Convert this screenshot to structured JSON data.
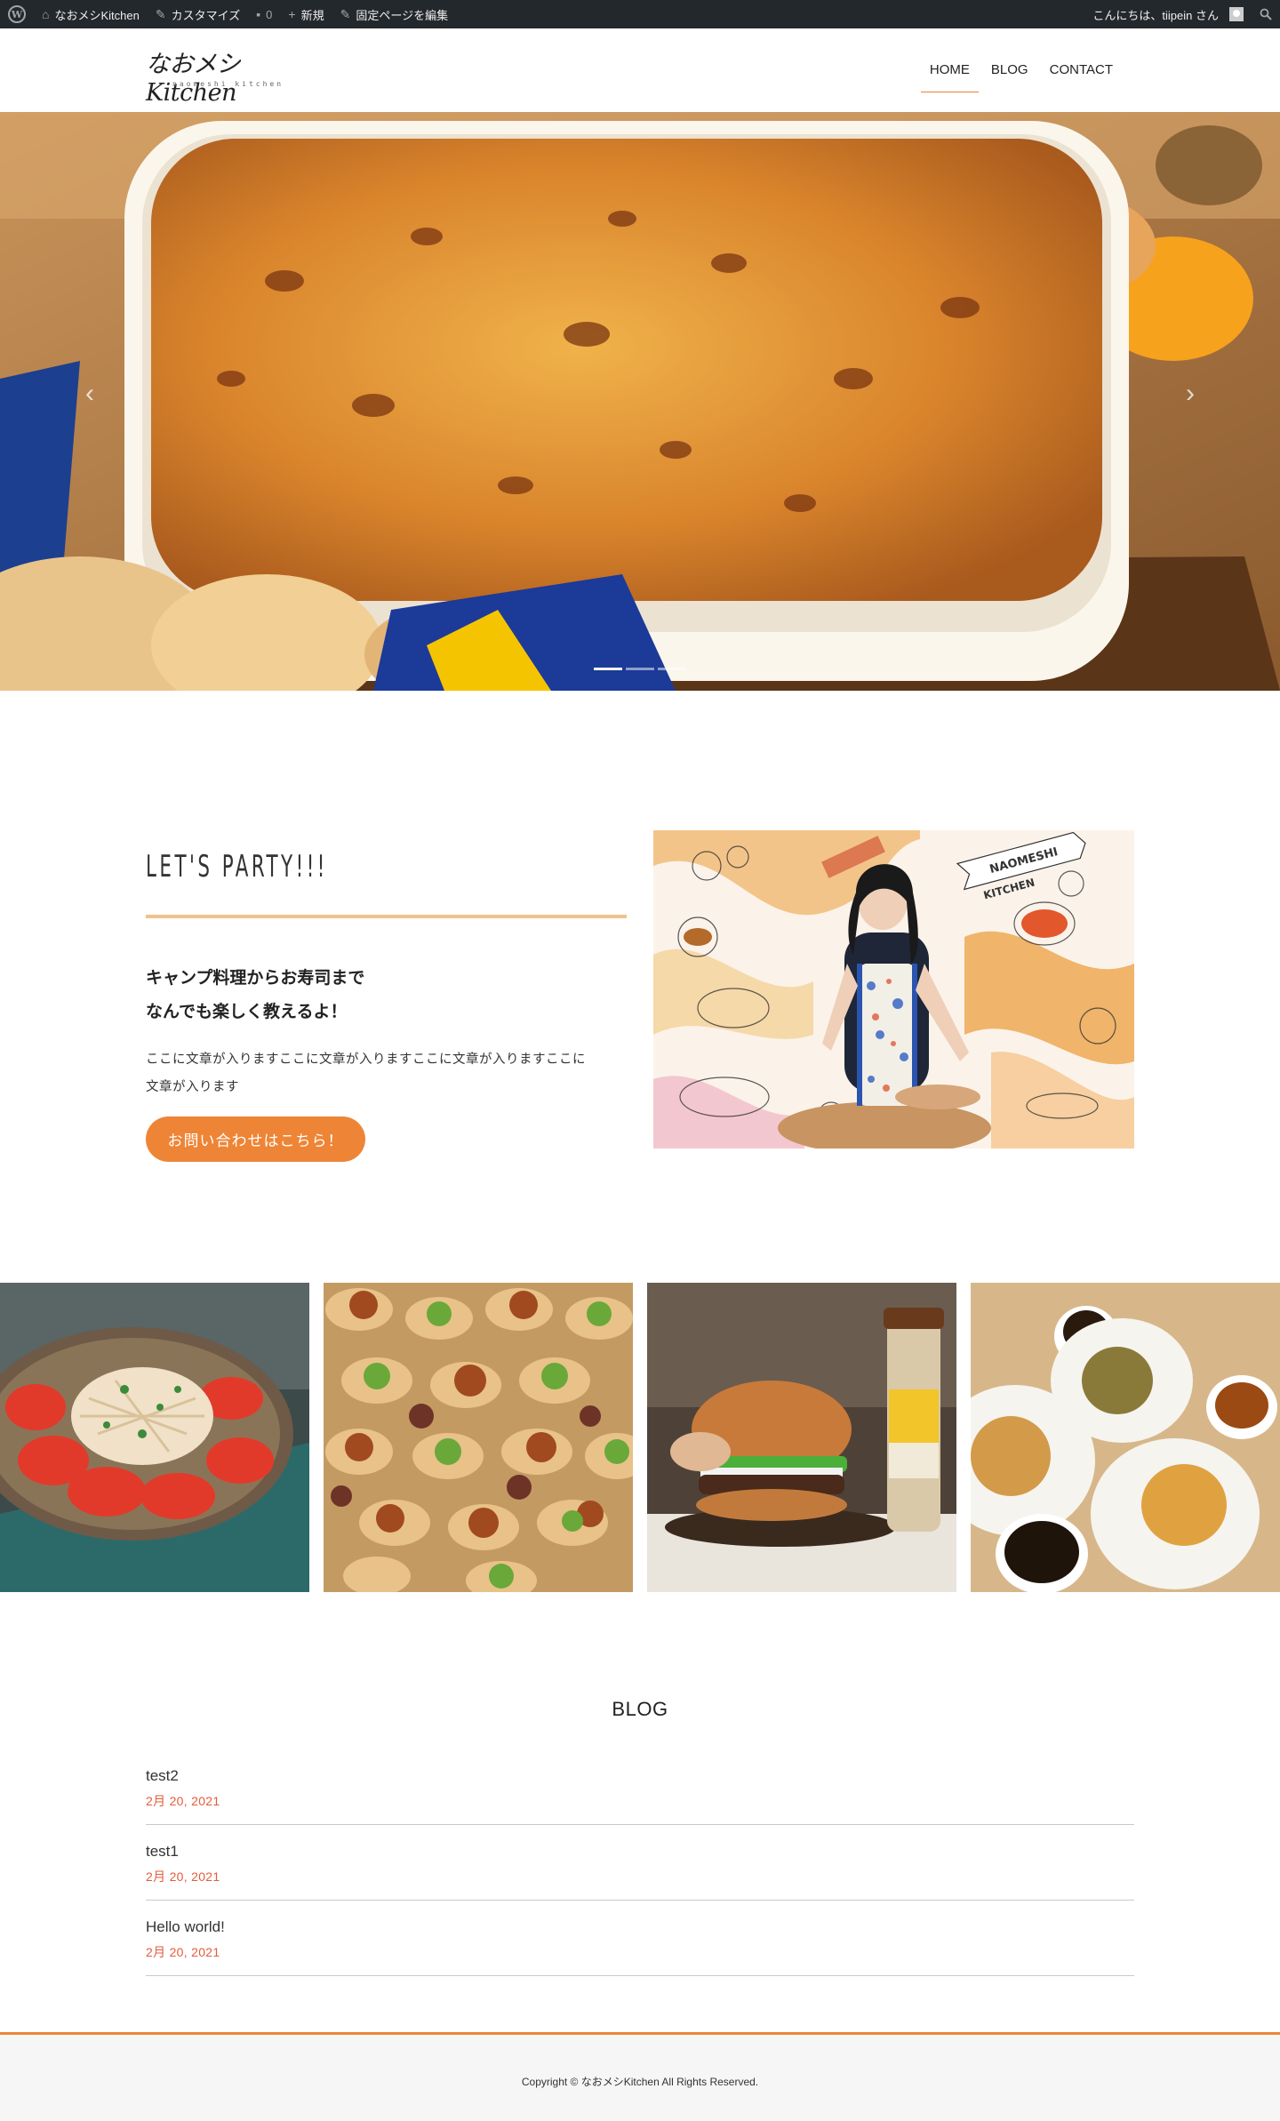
{
  "admin_bar": {
    "site_name": "なおメシKitchen",
    "customize": "カスタマイズ",
    "comments_count": "0",
    "new": "新規",
    "edit_page": "固定ページを編集",
    "greeting": "こんにちは、tiipein さん"
  },
  "header": {
    "logo_text": "なおメシKitchen",
    "logo_sub": "naomeshi kitchen",
    "nav": [
      {
        "label": "HOME",
        "active": true
      },
      {
        "label": "BLOG",
        "active": false
      },
      {
        "label": "CONTACT",
        "active": false
      }
    ]
  },
  "hero": {
    "prev_icon": "chevron-left-icon",
    "next_icon": "chevron-right-icon",
    "prev_glyph": "‹",
    "next_glyph": "›",
    "slides": 3,
    "active_slide": 1
  },
  "party": {
    "title": "LET'S PARTY!!!",
    "lead_line1": "キャンプ料理からお寿司まで",
    "lead_line2": "なんでも楽しく教えるよ！",
    "body_line1": "ここに文章が入りますここに文章が入りますここに文章が入りますここに",
    "body_line2": "文章が入ります",
    "button": "お問い合わせはこちら！",
    "badge_line1": "NAOMESHI",
    "badge_line2": "KITCHEN"
  },
  "blog": {
    "heading": "BLOG",
    "posts": [
      {
        "title": "test2",
        "date": "2月 20, 2021"
      },
      {
        "title": "test1",
        "date": "2月 20, 2021"
      },
      {
        "title": "Hello world!",
        "date": "2月 20, 2021"
      }
    ]
  },
  "footer": {
    "copyright": "Copyright © なおメシKitchen All Rights Reserved."
  },
  "colors": {
    "accent": "#ee8536",
    "accent_light": "#f1c28e",
    "date": "#e55b3c",
    "admin_bar": "#23282d"
  }
}
